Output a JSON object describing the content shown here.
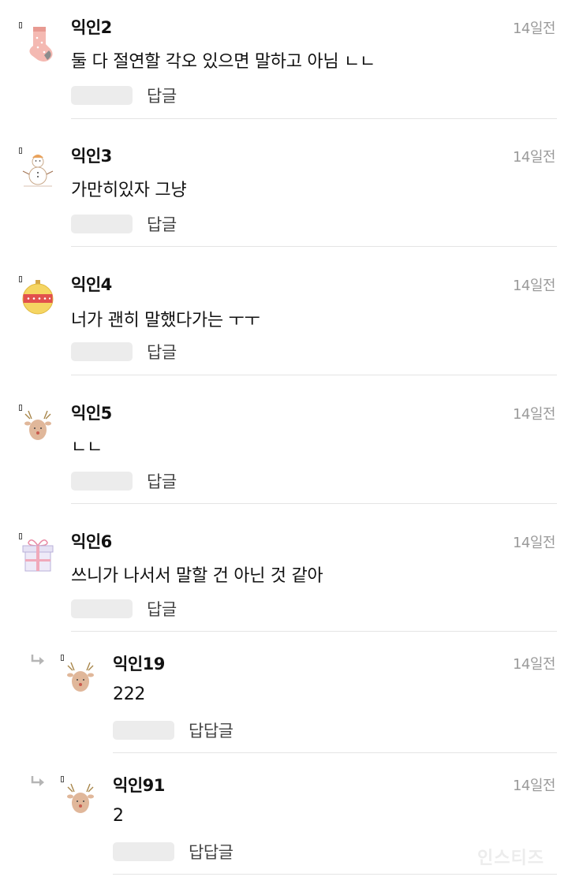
{
  "comments": [
    {
      "nickname": "익인2",
      "time": "14일전",
      "text": "둘 다 절연할 각오 있으면 말하고 아님 ㄴㄴ",
      "reply_label": "답글",
      "avatar": "sock-icon"
    },
    {
      "nickname": "익인3",
      "time": "14일전",
      "text": "가만히있자 그냥",
      "reply_label": "답글",
      "avatar": "snowman-icon"
    },
    {
      "nickname": "익인4",
      "time": "14일전",
      "text": "너가 괜히 말했다가는 ㅜㅜ",
      "reply_label": "답글",
      "avatar": "ornament-icon"
    },
    {
      "nickname": "익인5",
      "time": "14일전",
      "text": "ㄴㄴ",
      "reply_label": "답글",
      "avatar": "reindeer-icon"
    },
    {
      "nickname": "익인6",
      "time": "14일전",
      "text": "쓰니가 나서서 말할 건 아닌 것 같아",
      "reply_label": "답글",
      "avatar": "gift-box-icon"
    }
  ],
  "replies": [
    {
      "nickname": "익인19",
      "time": "14일전",
      "text": "222",
      "reply_label": "답답글",
      "avatar": "reindeer-icon"
    },
    {
      "nickname": "익인91",
      "time": "14일전",
      "text": "2",
      "reply_label": "답답글",
      "avatar": "reindeer-icon"
    }
  ],
  "watermark": "인스티즈",
  "colors": {
    "text": "#111111",
    "time": "#9a9a9a",
    "placeholder": "#ececec",
    "divider": "#e4e4e4"
  }
}
